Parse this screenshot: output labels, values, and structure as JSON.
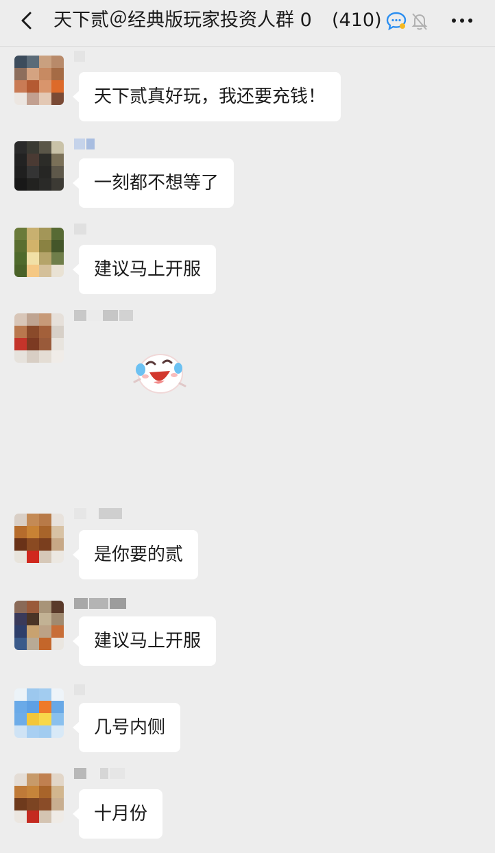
{
  "header": {
    "title": "天下贰＠经典版玩家投资人群 0",
    "member_count": "(410)"
  },
  "colors": {
    "background": "#ededed",
    "bubble": "#ffffff",
    "text": "#1b1b1b"
  },
  "icons": {
    "back": "chevron-left-icon",
    "group_badge": "chat-bubble-icon",
    "mute": "bell-off-icon",
    "more": "more-dots-icon"
  },
  "messages": [
    {
      "text": "天下贰真好玩，我还要充钱！"
    },
    {
      "text": "一刻都不想等了"
    },
    {
      "text": "建议马上开服"
    },
    {
      "sticker": "laughing-dumpling-sticker"
    },
    {
      "text": "是你要的贰"
    },
    {
      "text": "建议马上开服"
    },
    {
      "text": "几号内侧"
    },
    {
      "text": "十月份"
    }
  ]
}
